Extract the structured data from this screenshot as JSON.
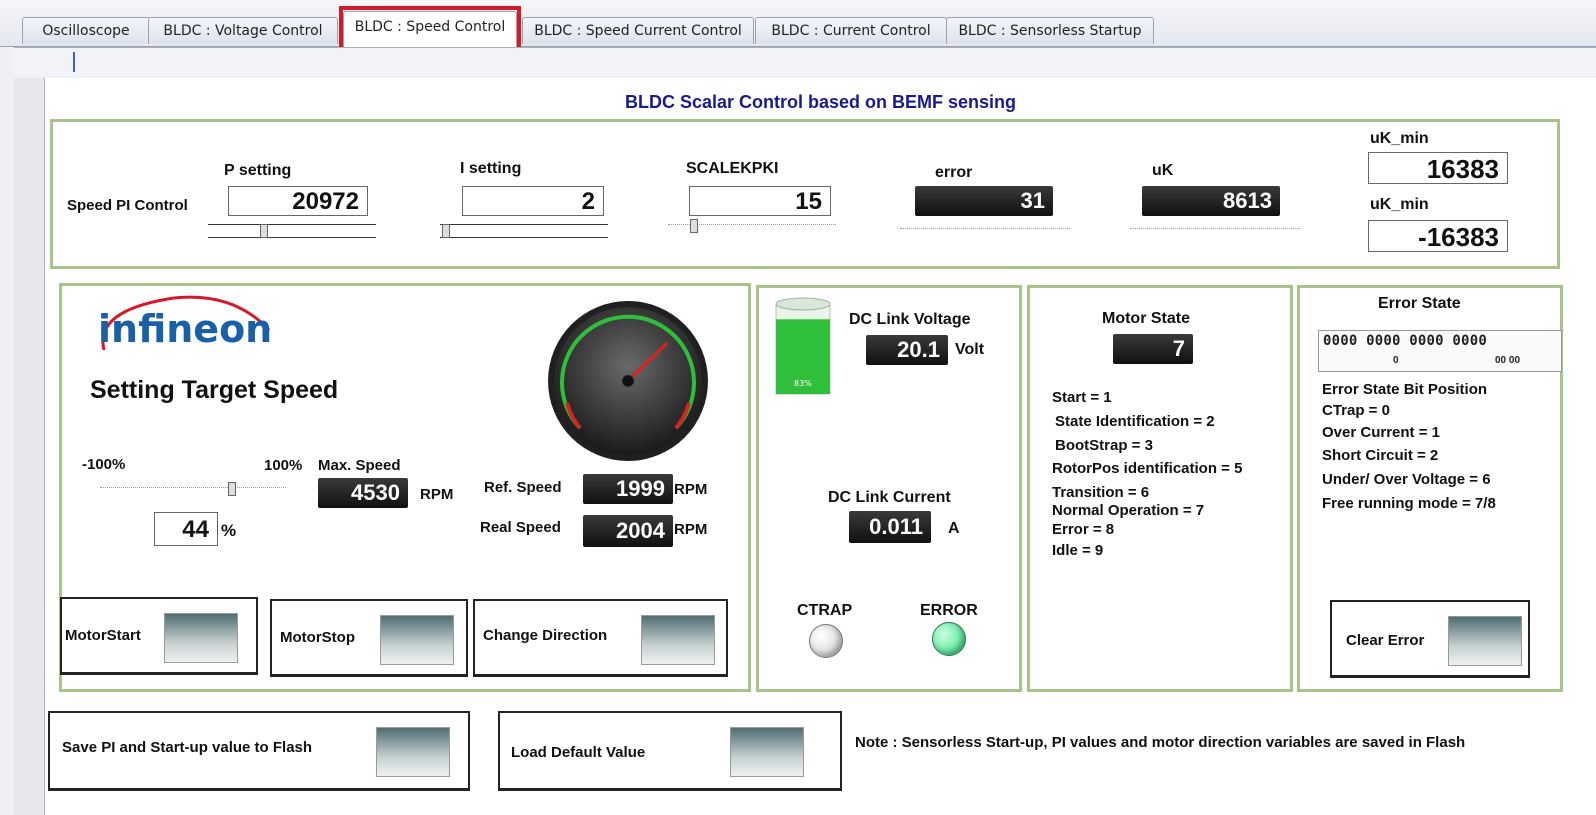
{
  "tabs": [
    {
      "label": "Oscilloscope"
    },
    {
      "label": "BLDC : Voltage Control"
    },
    {
      "label": "BLDC : Speed Control"
    },
    {
      "label": "BLDC : Speed Current Control"
    },
    {
      "label": "BLDC : Current  Control"
    },
    {
      "label": "BLDC : Sensorless Startup"
    }
  ],
  "header": {
    "title": "BLDC Scalar Control based on BEMF sensing"
  },
  "pi": {
    "section_label": "Speed PI Control",
    "p_label": "P setting",
    "p_value": "20972",
    "i_label": "I setting",
    "i_value": "2",
    "scale_label": "SCALEKPKI",
    "scale_value": "15",
    "error_label": "error",
    "error_value": "31",
    "uk_label": "uK",
    "uk_value": "8613",
    "ukmin1_label": "uK_min",
    "ukmin1_value": "16383",
    "ukmin2_label": "uK_min",
    "ukmin2_value": "-16383"
  },
  "speed": {
    "logo_text": "infineon",
    "title": "Setting Target Speed",
    "min_label": "-100%",
    "max_label": "100%",
    "max_speed_label": "Max. Speed",
    "max_speed_value": "4530",
    "rpm_unit": "RPM",
    "percent_value": "44",
    "percent_unit": "%",
    "ref_speed_label": "Ref. Speed",
    "ref_speed_value": "1999",
    "real_speed_label": "Real Speed",
    "real_speed_value": "2004",
    "gauge_level": 0.67,
    "motor_start": "MotorStart",
    "motor_stop": "MotorStop",
    "change_direction": "Change Direction"
  },
  "dclink": {
    "voltage_label": "DC Link Voltage",
    "voltage_value": "20.1",
    "voltage_unit": "Volt",
    "tank_level": 0.83,
    "tank_text": "83%",
    "current_label": "DC Link Current",
    "current_value": "0.011",
    "current_unit": "A",
    "ctrap_label": "CTRAP",
    "error_label": "ERROR",
    "ctrap_color": "#cccccc",
    "error_color": "#2ee080"
  },
  "motor_state": {
    "title": "Motor State",
    "value": "7",
    "lines": [
      "Start = 1",
      "State Identification = 2",
      "BootStrap = 3",
      "RotorPos identification = 5",
      "Transition = 6",
      "Normal Operation = 7",
      "Error = 8",
      "Idle = 9"
    ]
  },
  "error_state": {
    "title": "Error State",
    "bits": "0000 0000 0000 0000",
    "sub_left": "0",
    "sub_right": "00 00",
    "bit_heading": "Error State Bit Position",
    "lines": [
      "CTrap = 0",
      "Over Current = 1",
      "Short Circuit = 2",
      "Under/ Over Voltage = 6",
      "Free running mode = 7/8"
    ],
    "clear_label": "Clear Error"
  },
  "footer": {
    "save_label": "Save PI and Start-up value to Flash",
    "load_label": "Load Default Value",
    "note": "Note : Sensorless Start-up,  PI values and motor direction variables are saved in Flash"
  },
  "colors": {
    "accent": "#1a1a8c",
    "highlight": "#d6182b",
    "panel_border": "#a9c48a"
  }
}
